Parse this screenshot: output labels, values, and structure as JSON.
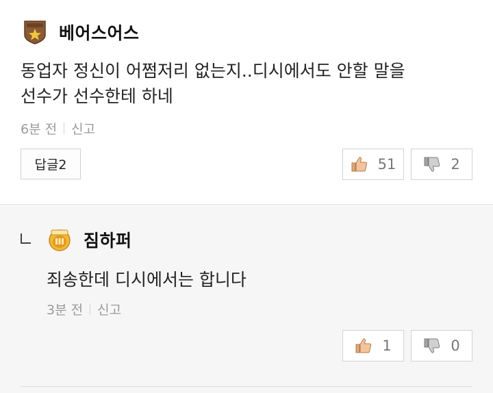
{
  "comment": {
    "author": "베어스어스",
    "badge_icon": "junior-star-badge-icon",
    "text_line1": "동업자 정신이 어쩜저리 없는지..디시에서도 안할 말을",
    "text_line2": "선수가 선수한테 하네",
    "time": "6분 전",
    "report": "신고",
    "reply_button": "답글2",
    "likes": "51",
    "dislikes": "2"
  },
  "reply": {
    "author": "짐하퍼",
    "badge_icon": "master-gold-badge-icon",
    "text": "죄송한데 디시에서는 합니다",
    "time": "3분 전",
    "report": "신고",
    "likes": "1",
    "dislikes": "0"
  }
}
